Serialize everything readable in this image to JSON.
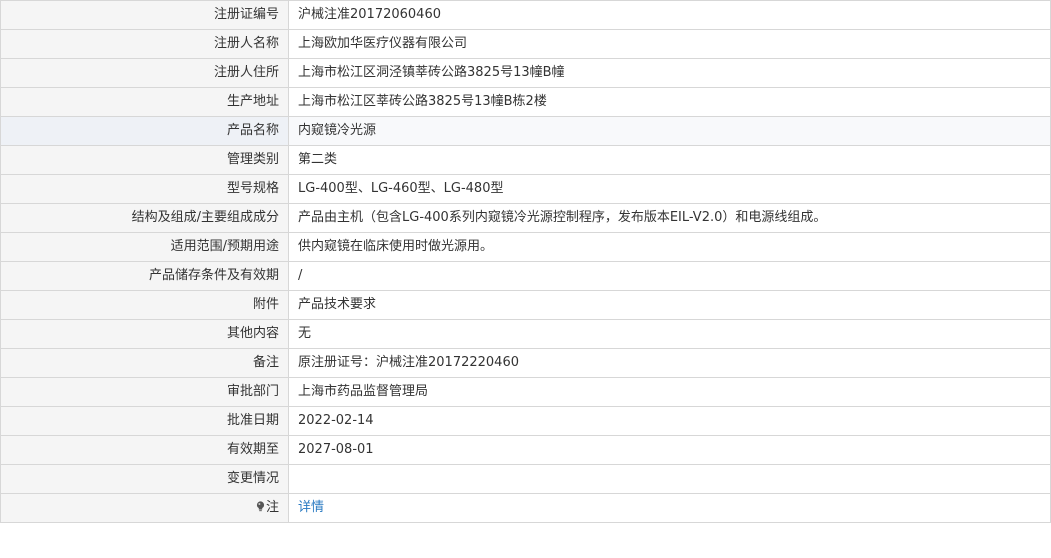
{
  "rows": [
    {
      "label": "注册证编号",
      "value": "沪械注准20172060460"
    },
    {
      "label": "注册人名称",
      "value": "上海欧加华医疗仪器有限公司"
    },
    {
      "label": "注册人住所",
      "value": "上海市松江区洞泾镇莘砖公路3825号13幢B幢"
    },
    {
      "label": "生产地址",
      "value": "上海市松江区莘砖公路3825号13幢B栋2楼"
    },
    {
      "label": "产品名称",
      "value": "内窥镜冷光源"
    },
    {
      "label": "管理类别",
      "value": "第二类"
    },
    {
      "label": "型号规格",
      "value": "LG-400型、LG-460型、LG-480型"
    },
    {
      "label": "结构及组成/主要组成成分",
      "value": "产品由主机（包含LG-400系列内窥镜冷光源控制程序，发布版本EIL-V2.0）和电源线组成。"
    },
    {
      "label": "适用范围/预期用途",
      "value": "供内窥镜在临床使用时做光源用。"
    },
    {
      "label": "产品储存条件及有效期",
      "value": "/"
    },
    {
      "label": "附件",
      "value": "产品技术要求"
    },
    {
      "label": "其他内容",
      "value": "无"
    },
    {
      "label": "备注",
      "value": "原注册证号：沪械注准20172220460"
    },
    {
      "label": "审批部门",
      "value": "上海市药品监督管理局"
    },
    {
      "label": "批准日期",
      "value": "2022-02-14"
    },
    {
      "label": "有效期至",
      "value": "2027-08-01"
    },
    {
      "label": "变更情况",
      "value": ""
    }
  ],
  "note": {
    "icon": "lightbulb-icon",
    "label": "注",
    "link": "详情"
  },
  "colors": {
    "label_bg": "#f5f5f5",
    "border": "#d7d7d7",
    "link": "#2a7ac2",
    "highlight_row": "#eef1f6"
  }
}
